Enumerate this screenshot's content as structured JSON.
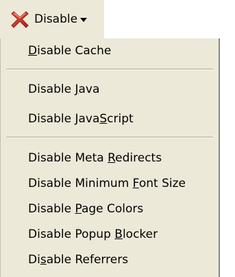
{
  "toolbar": {
    "disable_label": "Disable",
    "icon": "red-x-icon",
    "accent_color": "#d62c1f"
  },
  "menu": {
    "items": [
      {
        "pre": "",
        "access": "D",
        "post": "isable Cache"
      },
      {
        "pre": "Disable ",
        "access": "J",
        "post": "ava"
      },
      {
        "pre": "Disable Java",
        "access": "S",
        "post": "cript"
      },
      {
        "pre": "Disable Meta ",
        "access": "R",
        "post": "edirects"
      },
      {
        "pre": "Disable Minimum ",
        "access": "F",
        "post": "ont Size"
      },
      {
        "pre": "Disable ",
        "access": "P",
        "post": "age Colors"
      },
      {
        "pre": "Disable Popup ",
        "access": "B",
        "post": "locker"
      },
      {
        "pre": "Di",
        "access": "s",
        "post": "able Referrers"
      }
    ]
  }
}
